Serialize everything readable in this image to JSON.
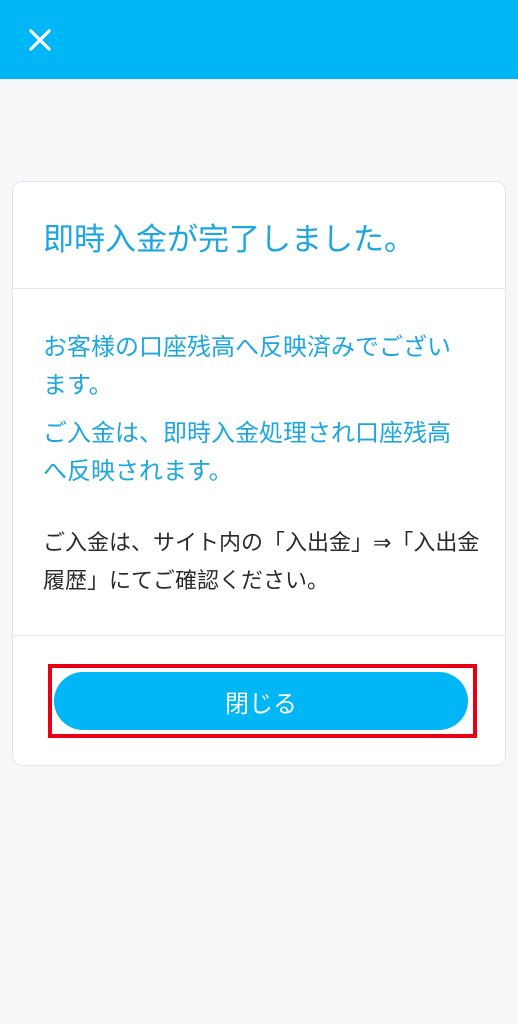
{
  "header": {
    "close_icon": "close-icon",
    "bg_color": "#00b6f5"
  },
  "dialog": {
    "title": "即時入金が完了しました。",
    "message_1": "お客様の口座残高へ反映済みでございます。",
    "message_2": "ご入金は、即時入金処理され口座残高へ反映されます。",
    "note": "ご入金は、サイト内の「入出金」⇒「入出金履歴」にてご確認ください。",
    "close_button_label": "閉じる",
    "text_color": "#1ea7de",
    "highlight_color": "#e60012"
  }
}
